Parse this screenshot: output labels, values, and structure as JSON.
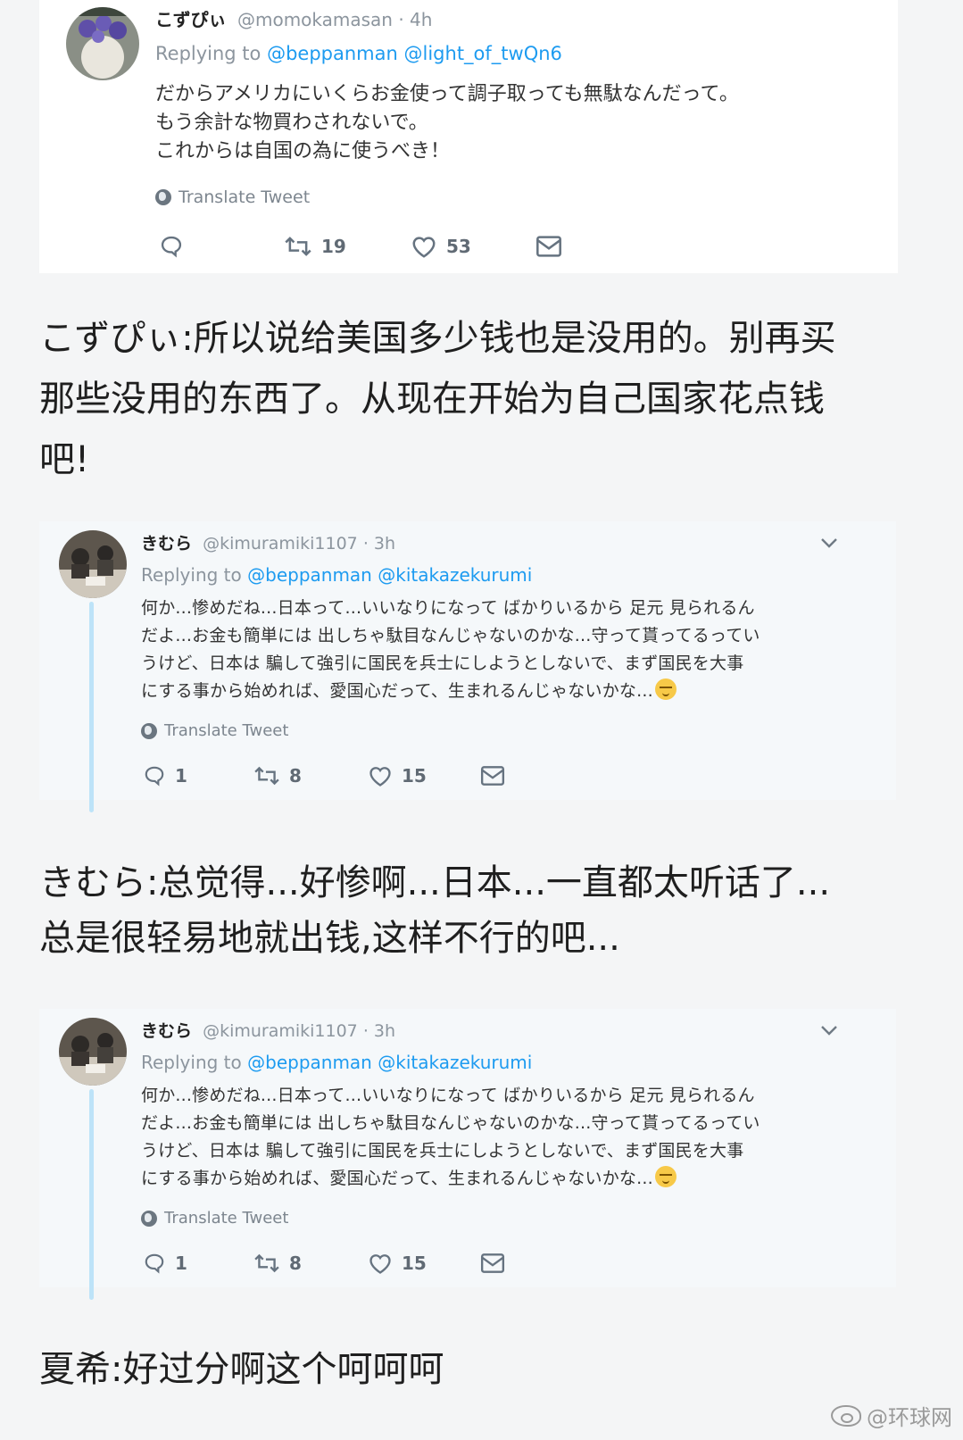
{
  "tweet1": {
    "name": "こずぴぃ",
    "handle": "@momokamasan",
    "time": "· 4h",
    "replying_to": "Replying to",
    "mention_1": "@beppanman",
    "mention_2": "@light_of_twQn6",
    "body": [
      "だからアメリカにいくらお金使って調子取っても無駄なんだって。",
      "もう余計な物買わされないで。",
      "これからは自国の為に使うべき！"
    ],
    "translate": "Translate Tweet",
    "reply_count": "",
    "retweet_count": "19",
    "like_count": "53"
  },
  "caption1": [
    "こずぴぃ:所以说给美国多少钱也是没用的。别再买",
    "那些没用的东西了。从现在开始为自己国家花点钱",
    "吧!"
  ],
  "tweet2": {
    "name": "きむら",
    "handle": "@kimuramiki1107",
    "time": "· 3h",
    "replying_to": "Replying to",
    "mention_1": "@beppanman",
    "mention_2": "@kitakazekurumi",
    "body": [
      "何か...惨めだね...日本って...いいなりになって ばかりいるから 足元 見られるん",
      "だよ...お金も簡単には 出しちゃ駄目なんじゃないのかな...守って貰ってるってい",
      "うけど、日本は 騙して強引に国民を兵士にしようとしないで、まず国民を大事",
      "にする事から始めれば、愛国心だって、生まれるんじゃないかな..."
    ],
    "translate": "Translate Tweet",
    "reply_count": "1",
    "retweet_count": "8",
    "like_count": "15"
  },
  "caption2": [
    "きむら:总觉得...好惨啊...日本...一直都太听话了...",
    "总是很轻易地就出钱,这样不行的吧..."
  ],
  "tweet3": {
    "name": "きむら",
    "handle": "@kimuramiki1107",
    "time": "· 3h",
    "replying_to": "Replying to",
    "mention_1": "@beppanman",
    "mention_2": "@kitakazekurumi",
    "body": [
      "何か...惨めだね...日本って...いいなりになって ばかりいるから 足元 見られるん",
      "だよ...お金も簡単には 出しちゃ駄目なんじゃないのかな...守って貰ってるってい",
      "うけど、日本は 騙して強引に国民を兵士にしようとしないで、まず国民を大事",
      "にする事から始めれば、愛国心だって、生まれるんじゃないかな..."
    ],
    "translate": "Translate Tweet",
    "reply_count": "1",
    "retweet_count": "8",
    "like_count": "15"
  },
  "caption3": [
    "夏希:好过分啊这个呵呵呵"
  ],
  "watermark": "@环球网",
  "colors": {
    "mention": "#1d9bf0",
    "thread_line": "#bde3f8",
    "tweet_bg_blue": "#f5f8fa"
  },
  "icons": [
    "reply-icon",
    "retweet-icon",
    "like-icon",
    "dm-icon",
    "globe-icon",
    "chevron-down-icon",
    "emoji-relieved-icon",
    "weibo-icon"
  ]
}
